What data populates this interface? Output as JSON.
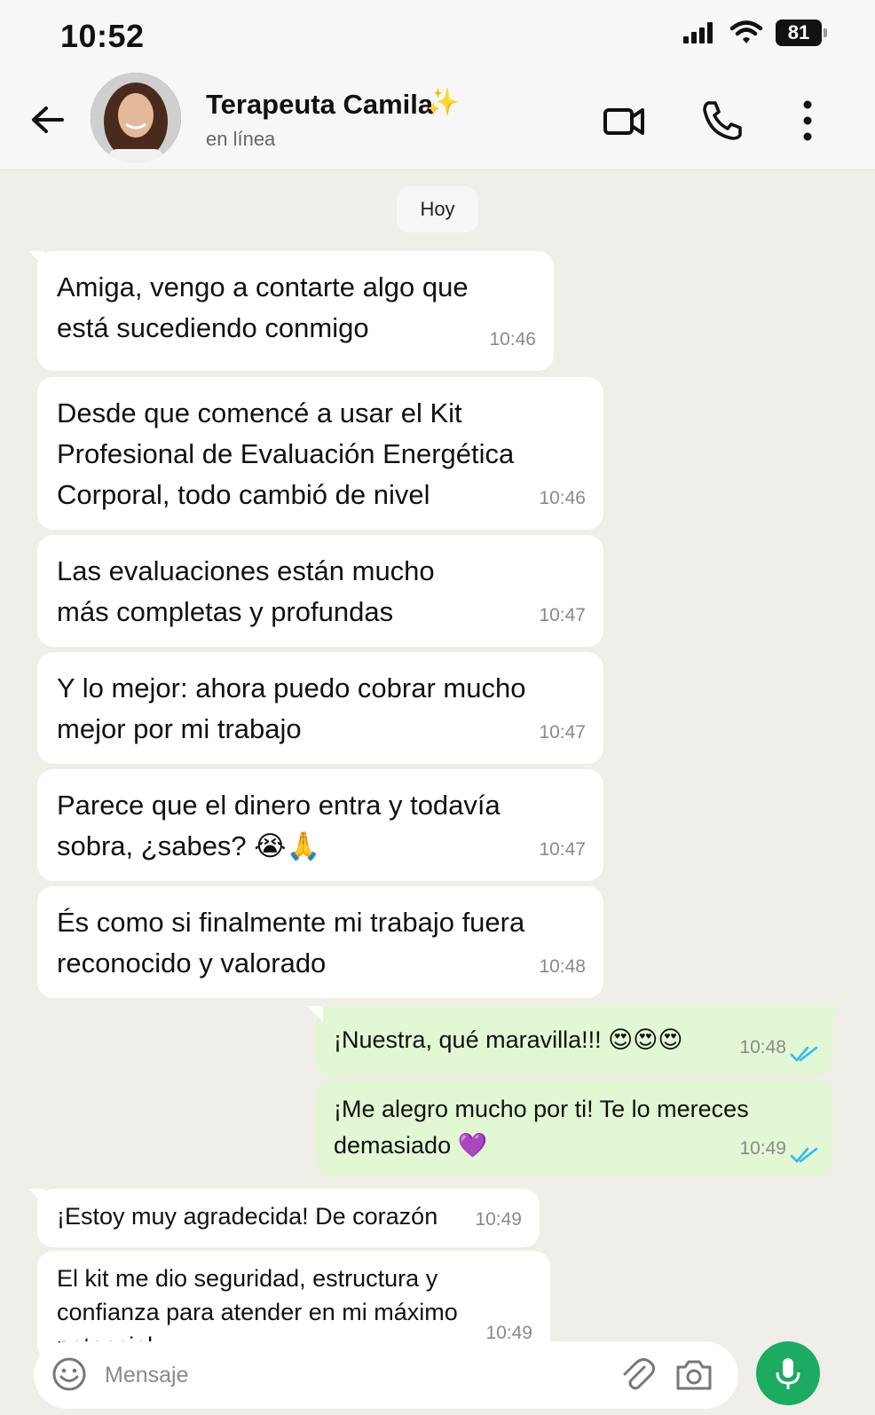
{
  "status_bar": {
    "time": "10:52",
    "battery": "81"
  },
  "header": {
    "contact_name": "Terapeuta Camila",
    "name_emoji": "✨",
    "contact_status": "en línea"
  },
  "date_chip": "Hoy",
  "messages": [
    {
      "direction": "in",
      "text": "Amiga, vengo a contarte algo que está sucediendo conmigo",
      "time": "10:46"
    },
    {
      "direction": "in",
      "text": "Desde que comencé a usar el Kit Profesional de Evaluación Energética Corporal, todo cambió de nivel",
      "time": "10:46"
    },
    {
      "direction": "in",
      "text": "Las evaluaciones están mucho más completas y profundas",
      "time": "10:47"
    },
    {
      "direction": "in",
      "text": "Y lo mejor: ahora puedo cobrar mucho mejor por mi trabajo",
      "time": "10:47"
    },
    {
      "direction": "in",
      "text": "Parece que el dinero entra y todavía sobra, ¿sabes? 😭🙏",
      "time": "10:47"
    },
    {
      "direction": "in",
      "text": "És como si finalmente mi trabajo fuera reconocido y valorado",
      "time": "10:48"
    },
    {
      "direction": "out",
      "text": "¡Nuestra, qué maravilla!!! 😍😍😍",
      "time": "10:48",
      "status": "read"
    },
    {
      "direction": "out",
      "text": "¡Me alegro mucho por ti! Te lo mereces demasiado 💜",
      "time": "10:49",
      "status": "read"
    },
    {
      "direction": "in",
      "text": "¡Estoy muy agradecida! De corazón",
      "time": "10:49"
    },
    {
      "direction": "in",
      "text": "El kit me dio seguridad, estructura y confianza para atender en mi máximo potencial",
      "time": "10:49"
    }
  ],
  "input": {
    "placeholder": "Mensaje",
    "value": ""
  },
  "colors": {
    "incoming": "#ffffff",
    "outgoing": "#e2f7d3",
    "mic": "#1daa61",
    "ticks": "#34b7f1",
    "background": "#efeee8"
  }
}
